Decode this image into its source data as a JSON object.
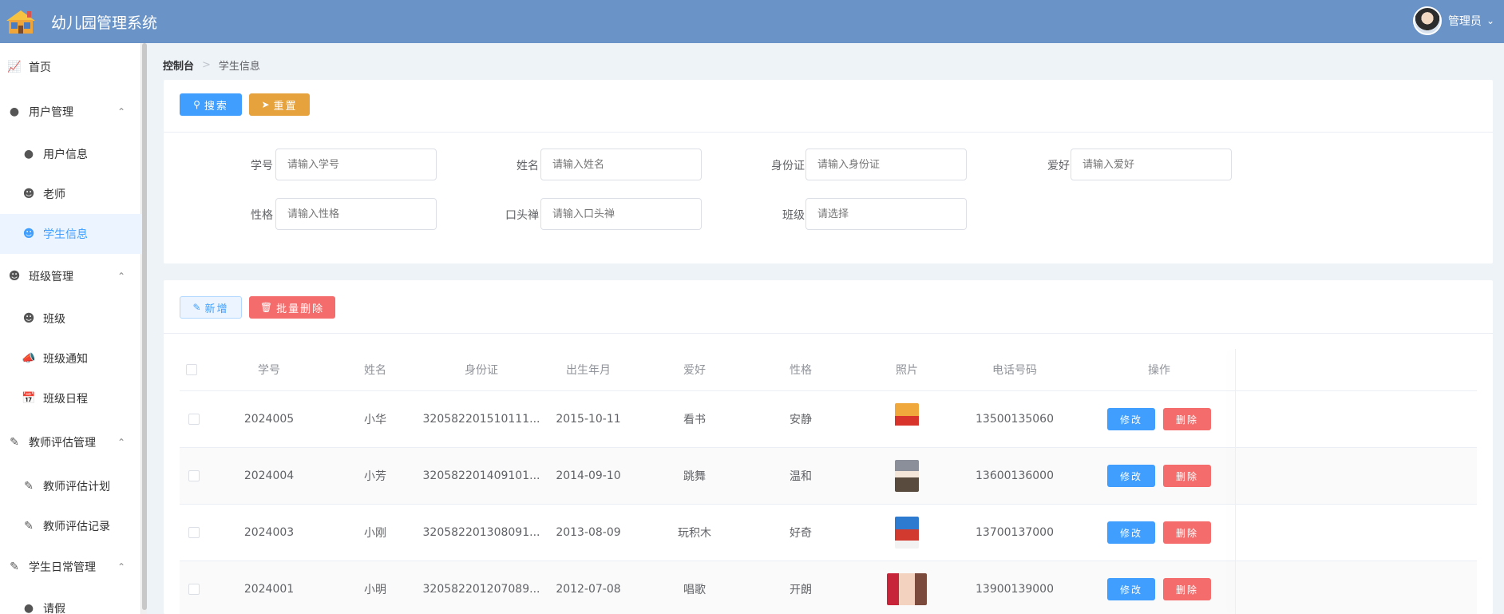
{
  "header": {
    "title": "幼儿园管理系统",
    "user_name": "管理员"
  },
  "sidebar": {
    "items": [
      {
        "label": "首页",
        "icon": "chart-icon",
        "kind": "home"
      },
      {
        "label": "用户管理",
        "icon": "user-group-icon",
        "kind": "group"
      },
      {
        "label": "用户信息",
        "icon": "user-info-icon",
        "kind": "sub"
      },
      {
        "label": "老师",
        "icon": "teacher-icon",
        "kind": "sub"
      },
      {
        "label": "学生信息",
        "icon": "student-icon",
        "kind": "sub",
        "active": true
      },
      {
        "label": "班级管理",
        "icon": "class-group-icon",
        "kind": "group"
      },
      {
        "label": "班级",
        "icon": "class-icon",
        "kind": "sub"
      },
      {
        "label": "班级通知",
        "icon": "megaphone-icon",
        "kind": "sub"
      },
      {
        "label": "班级日程",
        "icon": "calendar-icon",
        "kind": "sub"
      },
      {
        "label": "教师评估管理",
        "icon": "eval-group-icon",
        "kind": "group"
      },
      {
        "label": "教师评估计划",
        "icon": "plan-icon",
        "kind": "sub"
      },
      {
        "label": "教师评估记录",
        "icon": "record-icon",
        "kind": "sub"
      },
      {
        "label": "学生日常管理",
        "icon": "daily-group-icon",
        "kind": "group"
      },
      {
        "label": "请假",
        "icon": "leave-icon",
        "kind": "sub"
      }
    ]
  },
  "breadcrumb": {
    "root": "控制台",
    "current": "学生信息"
  },
  "search": {
    "search_label": "搜索",
    "reset_label": "重置",
    "fields": {
      "student_no": {
        "label": "学号",
        "placeholder": "请输入学号"
      },
      "name": {
        "label": "姓名",
        "placeholder": "请输入姓名"
      },
      "id_card": {
        "label": "身份证",
        "placeholder": "请输入身份证"
      },
      "hobby": {
        "label": "爱好",
        "placeholder": "请输入爱好"
      },
      "personality": {
        "label": "性格",
        "placeholder": "请输入性格"
      },
      "catchphrase": {
        "label": "口头禅",
        "placeholder": "请输入口头禅"
      },
      "class": {
        "label": "班级",
        "placeholder": "请选择"
      }
    }
  },
  "table": {
    "add_label": "新增",
    "batch_delete_label": "批量删除",
    "columns": [
      "学号",
      "姓名",
      "身份证",
      "出生年月",
      "爱好",
      "性格",
      "照片",
      "电话号码",
      "操作"
    ],
    "edit_label": "修改",
    "delete_label": "删除",
    "rows": [
      {
        "student_no": "2024005",
        "name": "小华",
        "id_card": "320582201510111...",
        "birth": "2015-10-11",
        "hobby": "看书",
        "personality": "安静",
        "phone": "13500135060"
      },
      {
        "student_no": "2024004",
        "name": "小芳",
        "id_card": "320582201409101...",
        "birth": "2014-09-10",
        "hobby": "跳舞",
        "personality": "温和",
        "phone": "13600136000"
      },
      {
        "student_no": "2024003",
        "name": "小刚",
        "id_card": "320582201308091...",
        "birth": "2013-08-09",
        "hobby": "玩积木",
        "personality": "好奇",
        "phone": "13700137000"
      },
      {
        "student_no": "2024001",
        "name": "小明",
        "id_card": "320582201207089...",
        "birth": "2012-07-08",
        "hobby": "唱歌",
        "personality": "开朗",
        "phone": "13900139000"
      }
    ]
  },
  "colors": {
    "header": "#6a94c8",
    "primary": "#409eff",
    "warning": "#e6a23c",
    "danger": "#f56c6c"
  }
}
